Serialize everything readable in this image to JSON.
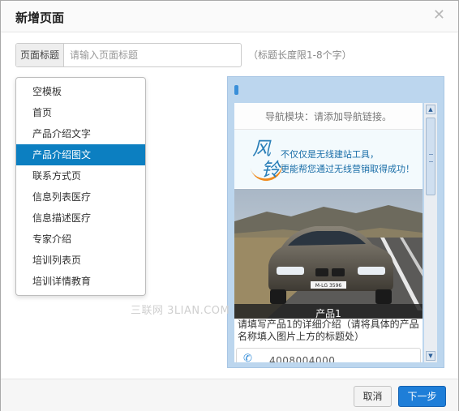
{
  "dialog": {
    "title": "新增页面",
    "close_icon": "close-icon"
  },
  "page_title_field": {
    "label": "页面标题",
    "placeholder": "请输入页面标题",
    "value": "",
    "hint": "（标题长度限1-8个字）"
  },
  "templates": {
    "selected": "产品介绍图文",
    "items": [
      {
        "label": "空模板"
      },
      {
        "label": "首页"
      },
      {
        "label": "产品介绍文字"
      },
      {
        "label": "产品介绍图文"
      },
      {
        "label": "联系方式页"
      },
      {
        "label": "信息列表医疗"
      },
      {
        "label": "信息描述医疗"
      },
      {
        "label": "专家介绍"
      },
      {
        "label": "培训列表页"
      },
      {
        "label": "培训详情教育"
      }
    ]
  },
  "preview": {
    "nav_module_text": "导航模块：请添加导航链接。",
    "banner": {
      "logo_char_1": "风",
      "logo_char_2": "铃",
      "line1": "不仅仅是无线建站工具，",
      "line2": "更能帮您通过无线营销取得成功！"
    },
    "product_caption": "产品1",
    "product_desc": "请填写产品1的详细介绍（请将具体的产品名称填入图片上方的标题处）",
    "phone_icon": "phone-icon",
    "phone_number": "4008004000",
    "car_plate": "M-LG 3596"
  },
  "watermark": "三联网 3LIAN.COM",
  "footer": {
    "cancel_label": "取消",
    "next_label": "下一步"
  },
  "colors": {
    "accent": "#1e7ed8",
    "selected_item": "#0c7fc1",
    "preview_bg": "#bcd6ee"
  }
}
